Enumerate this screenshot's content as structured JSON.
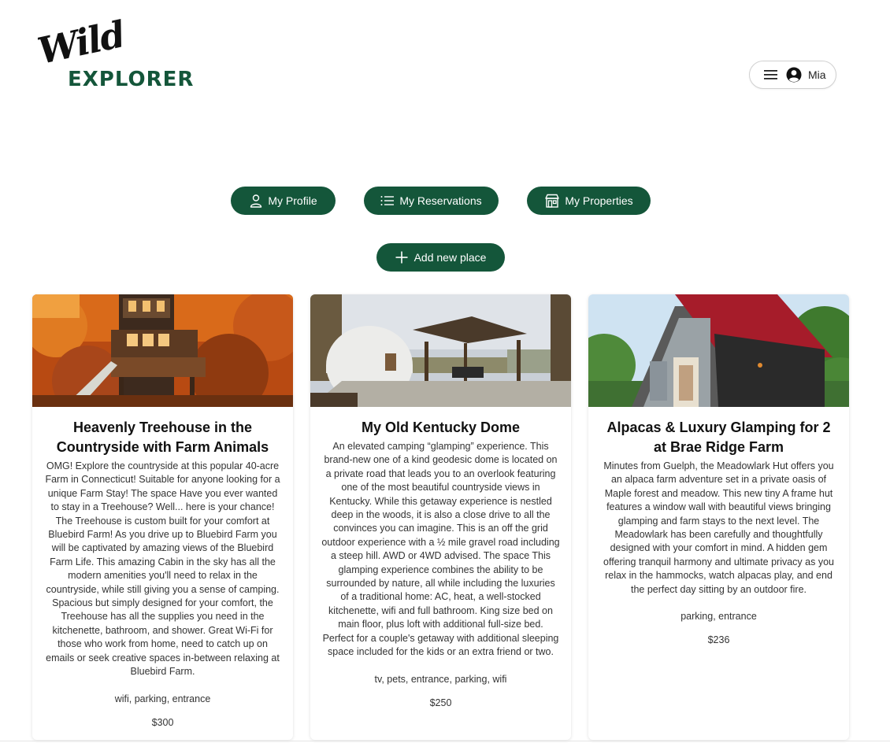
{
  "header": {
    "logo_script": "Wild",
    "logo_block": "EXPLORER",
    "menu_icon": "hamburger-icon",
    "avatar_icon": "user-circle-icon",
    "user_name": "Mia"
  },
  "nav": {
    "profile_label": "My Profile",
    "reservations_label": "My Reservations",
    "properties_label": "My Properties",
    "add_label": "Add new place"
  },
  "colors": {
    "brand": "#14563a",
    "button_text": "#ffffff"
  },
  "listings": [
    {
      "title": "Heavenly Treehouse in the Countryside with Farm Animals",
      "description": "OMG! Explore the countryside at this popular 40-acre Farm in Connecticut! Suitable for anyone looking for a unique Farm Stay! The space Have you ever wanted to stay in a Treehouse? Well... here is your chance! The Treehouse is custom built for your comfort at Bluebird Farm! As you drive up to Bluebird Farm you will be captivated by amazing views of the Bluebird Farm Life. This amazing Cabin in the sky has all the modern amenities you'll need to relax in the countryside, while still giving you a sense of camping. Spacious but simply designed for your comfort, the Treehouse has all the supplies you need in the kitchenette, bathroom, and shower. Great Wi-Fi for those who work from home, need to catch up on emails or seek creative spaces in-between relaxing at Bluebird Farm.",
      "tags": "wifi, parking, entrance",
      "price": "$300"
    },
    {
      "title": "My Old Kentucky Dome",
      "description": "An elevated camping “glamping” experience. This brand-new one of a kind geodesic dome is located on a private road that leads you to an overlook featuring one of the most beautiful countryside views in Kentucky. While this getaway experience is nestled deep in the woods, it is also a close drive to all the convinces you can imagine. This is an off the grid outdoor experience with a ½ mile gravel road including a steep hill. AWD or 4WD advised. The space This glamping experience combines the ability to be surrounded by nature, all while including the luxuries of a traditional home: AC, heat, a well-stocked kitchenette, wifi and full bathroom. King size bed on main floor, plus loft with additional full-size bed. Perfect for a couple's getaway with additional sleeping space included for the kids or an extra friend or two.",
      "tags": "tv, pets, entrance, parking, wifi",
      "price": "$250"
    },
    {
      "title": "Alpacas & Luxury Glamping for 2 at Brae Ridge Farm",
      "description": "Minutes from Guelph, the Meadowlark Hut offers you an alpaca farm adventure set in a private oasis of Maple forest and meadow. This new tiny A frame hut features a window wall with beautiful views bringing glamping and farm stays to the next level. The Meadowlark has been carefully and thoughtfully designed with your comfort in mind. A hidden gem offering tranquil harmony and ultimate privacy as you relax in the hammocks, watch alpacas play, and end the perfect day sitting by an outdoor fire.",
      "tags": "parking, entrance",
      "price": "$236"
    }
  ]
}
